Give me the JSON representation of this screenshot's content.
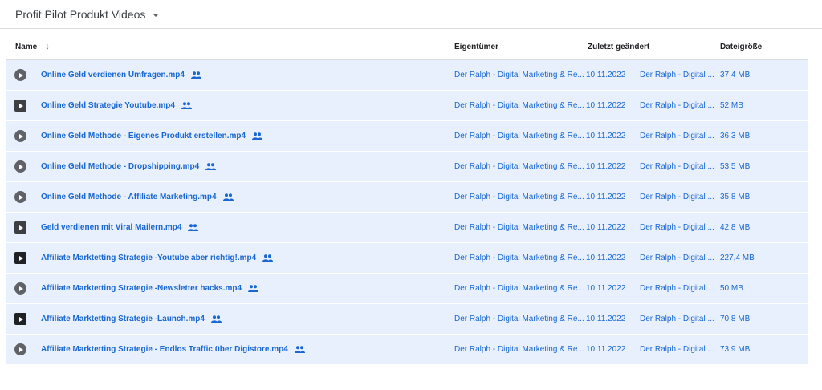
{
  "folder": {
    "title": "Profit Pilot Produkt Videos"
  },
  "columns": {
    "name": "Name",
    "owner": "Eigentümer",
    "modified": "Zuletzt geändert",
    "size": "Dateigröße"
  },
  "files": [
    {
      "name": "Online Geld verdienen Umfragen.mp4",
      "owner": "Der Ralph - Digital Marketing & Re...",
      "date": "10.11.2022",
      "modifier": "Der Ralph - Digital ...",
      "size": "37,4 MB",
      "icon": "video-circle-icon"
    },
    {
      "name": "Online Geld Strategie Youtube.mp4",
      "owner": "Der Ralph - Digital Marketing & Re...",
      "date": "10.11.2022",
      "modifier": "Der Ralph - Digital ...",
      "size": "52 MB",
      "icon": "video-thumb-icon"
    },
    {
      "name": "Online Geld Methode - Eigenes Produkt erstellen.mp4",
      "owner": "Der Ralph - Digital Marketing & Re...",
      "date": "10.11.2022",
      "modifier": "Der Ralph - Digital ...",
      "size": "36,3 MB",
      "icon": "video-circle-icon"
    },
    {
      "name": "Online Geld Methode - Dropshipping.mp4",
      "owner": "Der Ralph - Digital Marketing & Re...",
      "date": "10.11.2022",
      "modifier": "Der Ralph - Digital ...",
      "size": "53,5 MB",
      "icon": "video-circle-icon"
    },
    {
      "name": "Online Geld Methode - Affiliate Marketing.mp4",
      "owner": "Der Ralph - Digital Marketing & Re...",
      "date": "10.11.2022",
      "modifier": "Der Ralph - Digital ...",
      "size": "35,8 MB",
      "icon": "video-circle-icon"
    },
    {
      "name": "Geld verdienen mit Viral Mailern.mp4",
      "owner": "Der Ralph - Digital Marketing & Re...",
      "date": "10.11.2022",
      "modifier": "Der Ralph - Digital ...",
      "size": "42,8 MB",
      "icon": "video-thumb-icon"
    },
    {
      "name": "Affiliate Marktetting Strategie -Youtube aber richtig!.mp4",
      "owner": "Der Ralph - Digital Marketing & Re...",
      "date": "10.11.2022",
      "modifier": "Der Ralph - Digital ...",
      "size": "227,4 MB",
      "icon": "video-thumb-icon"
    },
    {
      "name": "Affiliate Marktetting Strategie -Newsletter hacks.mp4",
      "owner": "Der Ralph - Digital Marketing & Re...",
      "date": "10.11.2022",
      "modifier": "Der Ralph - Digital ...",
      "size": "50 MB",
      "icon": "video-circle-icon"
    },
    {
      "name": "Affiliate Marktetting Strategie -Launch.mp4",
      "owner": "Der Ralph - Digital Marketing & Re...",
      "date": "10.11.2022",
      "modifier": "Der Ralph - Digital ...",
      "size": "70,8 MB",
      "icon": "video-thumb-icon"
    },
    {
      "name": "Affiliate Marktetting Strategie - Endlos Traffic über Digistore.mp4",
      "owner": "Der Ralph - Digital Marketing & Re...",
      "date": "10.11.2022",
      "modifier": "Der Ralph - Digital ...",
      "size": "73,9 MB",
      "icon": "video-circle-icon"
    }
  ],
  "colors": {
    "selection": "#e8f0fe",
    "link": "#1967d2"
  }
}
